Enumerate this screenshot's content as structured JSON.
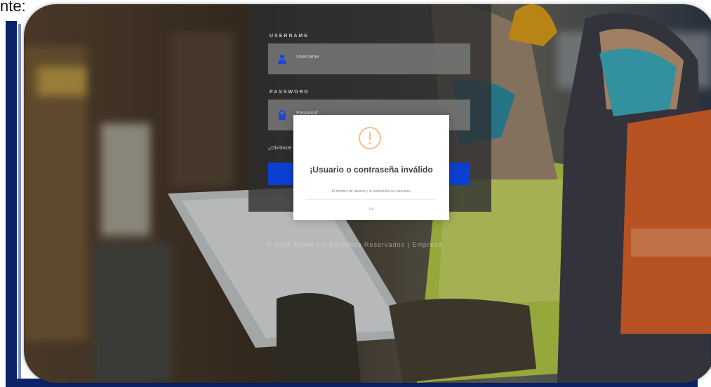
{
  "document": {
    "caption": "nte:"
  },
  "login": {
    "username_label": "USERNAME",
    "username_placeholder": "Username",
    "password_label": "PASSWORD",
    "password_placeholder": "Password",
    "forgot_label": "¿Olvidaste tu contraseña?",
    "login_button_label": ""
  },
  "footer": {
    "text": "© 2024 Todos los Derechos Reservados | Empresa"
  },
  "dialog": {
    "icon": "warning-icon",
    "title": "¡Usuario o contraseña inválido",
    "message": "El nombre de usuario y la contraseña no coinciden",
    "button_label": "Ok"
  },
  "colors": {
    "frame_blue": "#0b2469",
    "button_blue": "#0a3fd1",
    "warning_orange": "#f5c08a"
  }
}
